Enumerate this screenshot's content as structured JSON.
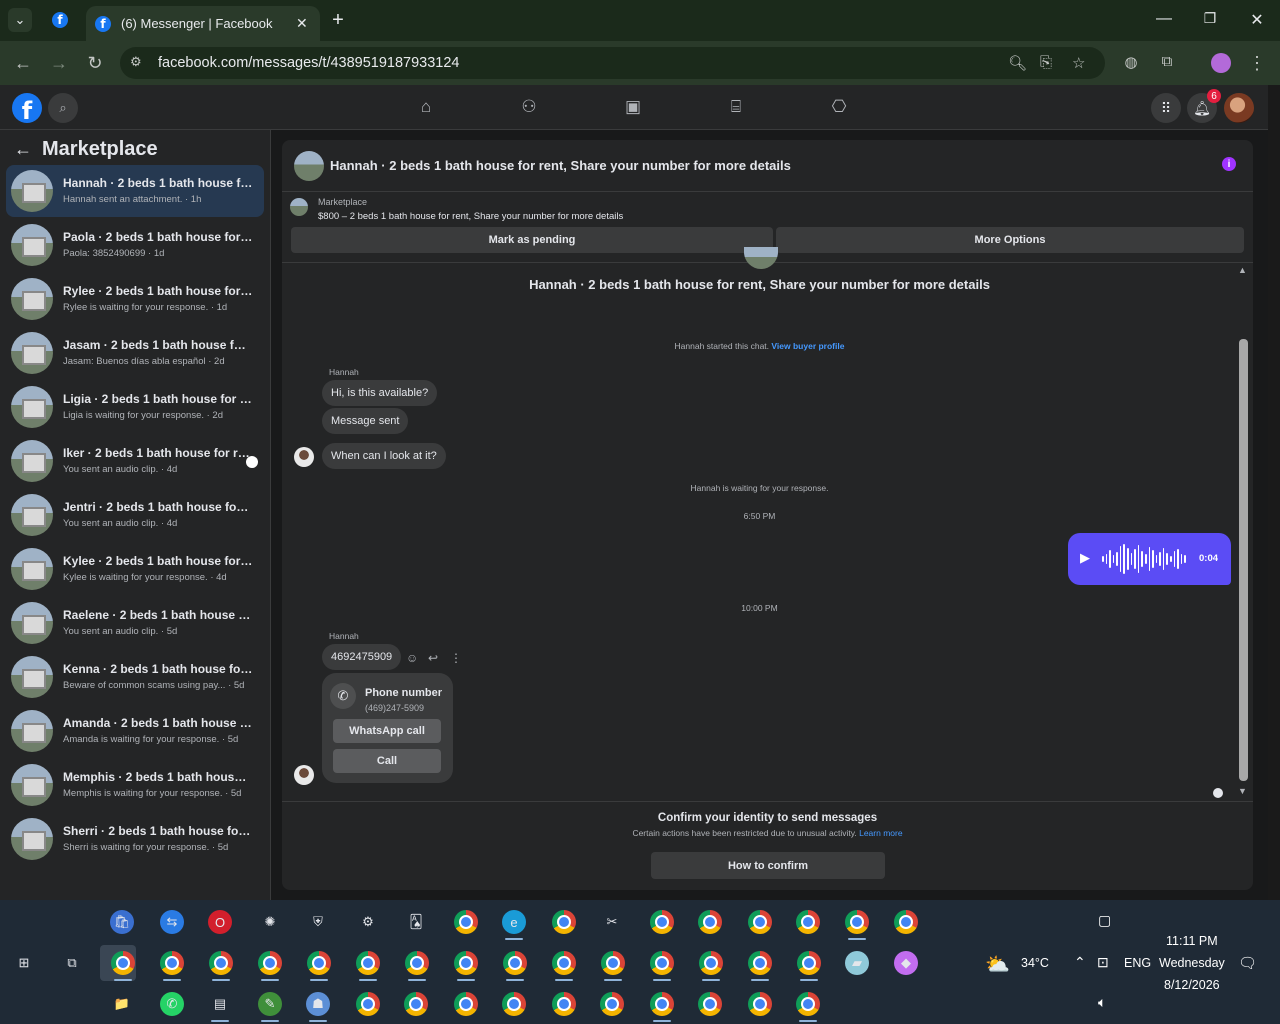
{
  "browser": {
    "tab_title": "(6) Messenger | Facebook",
    "url": "facebook.com/messages/t/4389519187933124"
  },
  "fb_header": {
    "notifications_count": "6"
  },
  "sidebar": {
    "title": "Marketplace",
    "conversations": [
      {
        "name": "Hannah · 2 beds 1 bath house for r...",
        "meta": "Hannah sent an attachment. · 1h",
        "active": true,
        "unread": false
      },
      {
        "name": "Paola · 2 beds 1 bath house for ren...",
        "meta": "Paola: 3852490699 · 1d",
        "active": false,
        "unread": false
      },
      {
        "name": "Rylee · 2 beds 1 bath house for ren...",
        "meta": "Rylee is waiting for your response. · 1d",
        "active": false,
        "unread": false
      },
      {
        "name": "Jasam · 2 beds 1 bath house for re...",
        "meta": "Jasam: Buenos días abla español · 2d",
        "active": false,
        "unread": false
      },
      {
        "name": "Ligia · 2 beds 1 bath house for rent...",
        "meta": "Ligia is waiting for your response. · 2d",
        "active": false,
        "unread": false
      },
      {
        "name": "Iker · 2 beds 1 bath house for re...",
        "meta": "You sent an audio clip. · 4d",
        "active": false,
        "unread": true
      },
      {
        "name": "Jentri · 2 beds 1 bath house for ren...",
        "meta": "You sent an audio clip. · 4d",
        "active": false,
        "unread": false
      },
      {
        "name": "Kylee · 2 beds 1 bath house for ren...",
        "meta": "Kylee is waiting for your response. · 4d",
        "active": false,
        "unread": false
      },
      {
        "name": "Raelene · 2 beds 1 bath house for r...",
        "meta": "You sent an audio clip. · 5d",
        "active": false,
        "unread": false
      },
      {
        "name": "Kenna · 2 beds 1 bath house for re...",
        "meta": "Beware of common scams using pay... · 5d",
        "active": false,
        "unread": false
      },
      {
        "name": "Amanda · 2 beds 1 bath house for ...",
        "meta": "Amanda is waiting for your response. · 5d",
        "active": false,
        "unread": false
      },
      {
        "name": "Memphis · 2 beds 1 bath house for...",
        "meta": "Memphis is waiting for your response. · 5d",
        "active": false,
        "unread": false
      },
      {
        "name": "Sherri · 2 beds 1 bath house for re...",
        "meta": "Sherri is waiting for your response. · 5d",
        "active": false,
        "unread": false
      }
    ]
  },
  "chat": {
    "title": "Hannah · 2 beds 1 bath house for rent, Share your number for more details",
    "marketplace_label": "Marketplace",
    "listing_desc": "$800 – 2 beds 1 bath house for rent, Share your number for more details",
    "btn_pending": "Mark as pending",
    "btn_more": "More Options",
    "listing_title": "Hannah · 2 beds 1 bath house for rent, Share your number for more details",
    "started": "Hannah started this chat.",
    "view_profile": "View buyer profile",
    "sender1": "Hannah",
    "msg1": "Hi, is this available?",
    "msg2": "Message sent",
    "msg3": "When can I look at it?",
    "waiting": "Hannah is waiting for your response.",
    "time1": "6:50 PM",
    "audio_duration": "0:04",
    "time2": "10:00 PM",
    "sender2": "Hannah",
    "msg4": "4692475909",
    "phone_label": "Phone number",
    "phone_number": "(469)247-5909",
    "btn_whatsapp": "WhatsApp call",
    "btn_call": "Call",
    "confirm_title": "Confirm your identity to send messages",
    "confirm_sub": "Certain actions have been restricted due to unusual activity.",
    "learn_more": "Learn more",
    "btn_how": "How to confirm"
  },
  "taskbar": {
    "weather": "34°C",
    "lang": "ENG",
    "time": "11:11 PM",
    "day": "Wednesday",
    "date": "8/12/2026"
  }
}
